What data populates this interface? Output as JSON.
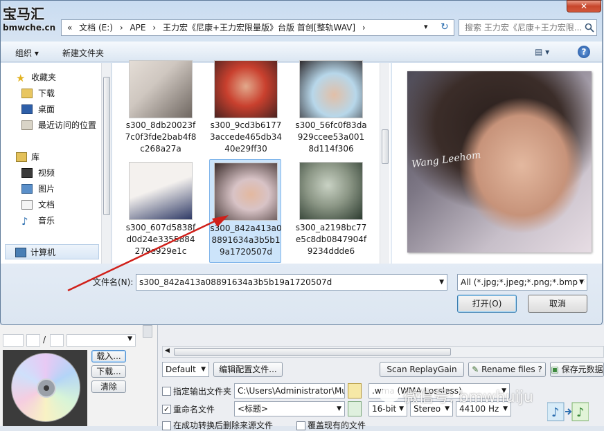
{
  "logo": {
    "top": "宝马汇",
    "bottom": "bmwche.cn"
  },
  "dialog": {
    "close_glyph": "✕",
    "nav": {
      "back_glyph": "◀",
      "forward_glyph": "▶",
      "recent_glyph": "▾",
      "refresh_glyph": "↻"
    },
    "breadcrumb": [
      "«",
      "文档 (E:)",
      "›",
      "APE",
      "›",
      "王力宏《尼康+王力宏限量版》台版 首创[整轨WAV]",
      "›"
    ],
    "search_placeholder": "搜索 王力宏《尼康+王力宏限...",
    "toolbar": {
      "organize": "组织 ▾",
      "new_folder": "新建文件夹",
      "view": "▤ ▾",
      "help": "?"
    },
    "sidebar": {
      "favorites_label": "收藏夹",
      "favorites": [
        "下载",
        "桌面",
        "最近访问的位置"
      ],
      "libraries_label": "库",
      "libraries": [
        "视频",
        "图片",
        "文档",
        "音乐"
      ],
      "computer_label": "计算机"
    },
    "files": [
      {
        "name": "s300_8db20023f7c0f3fde2bab4f8c268a27a",
        "selected": false,
        "c1": "#cfc7c0",
        "c2": "#6f6761"
      },
      {
        "name": "s300_9cd3b61773accede465db3440e29ff30",
        "selected": false,
        "c1": "#c9402e",
        "c2": "#4a2320"
      },
      {
        "name": "s300_56fc0f83da929ccee53a0018d114f306",
        "selected": false,
        "c1": "#b7d7ea",
        "c2": "#2e2a2d"
      },
      {
        "name": "s300_607d5838fd0d24e3355884279e929e1c",
        "selected": false,
        "c1": "#f4f1ee",
        "c2": "#2f3a66"
      },
      {
        "name": "s300_842a413a08891634a3b5b19a1720507d",
        "selected": true,
        "c1": "#d8c3c6",
        "c2": "#3a2c2a"
      },
      {
        "name": "s300_a2198bc77e5c8db0847904f9234ddde6",
        "selected": false,
        "c1": "#c9d2c4",
        "c2": "#2c3b2f"
      }
    ],
    "preview_signature": "Wang Leehom",
    "filename_label": "文件名(N):",
    "filename_value": "s300_842a413a08891634a3b5b19a1720507d",
    "filetype_value": "All (*.jpg;*.jpeg;*.png;*.bmp;*",
    "open_button": "打开(O)",
    "cancel_button": "取消"
  },
  "background_app": {
    "slash": "/",
    "load_button": "载入...",
    "download_button": "下载...",
    "clear_button": "清除",
    "preset_select": "Default",
    "edit_config_button": "编辑配置文件...",
    "scan_replaygain_button": "Scan ReplayGain",
    "rename_files_button": "Rename files ?",
    "save_metadata_button": "保存元数据",
    "output_folder_label": "指定输出文件夹",
    "output_folder_checked": false,
    "output_folder_path": "C:\\Users\\Administrator\\Music",
    "rename_label": "重命名文件",
    "rename_checked": true,
    "rename_pattern": "<标题>",
    "format_select": ".wma (WMA Lossless)",
    "bit_select": "16-bit",
    "channel_select": "Stereo",
    "rate_select": "44100 Hz",
    "bottom_label_1": "在成功转换后删除来源文件",
    "bottom_label_2": "覆盖现有的文件"
  },
  "watermark": "微信号: bmwhuiju"
}
